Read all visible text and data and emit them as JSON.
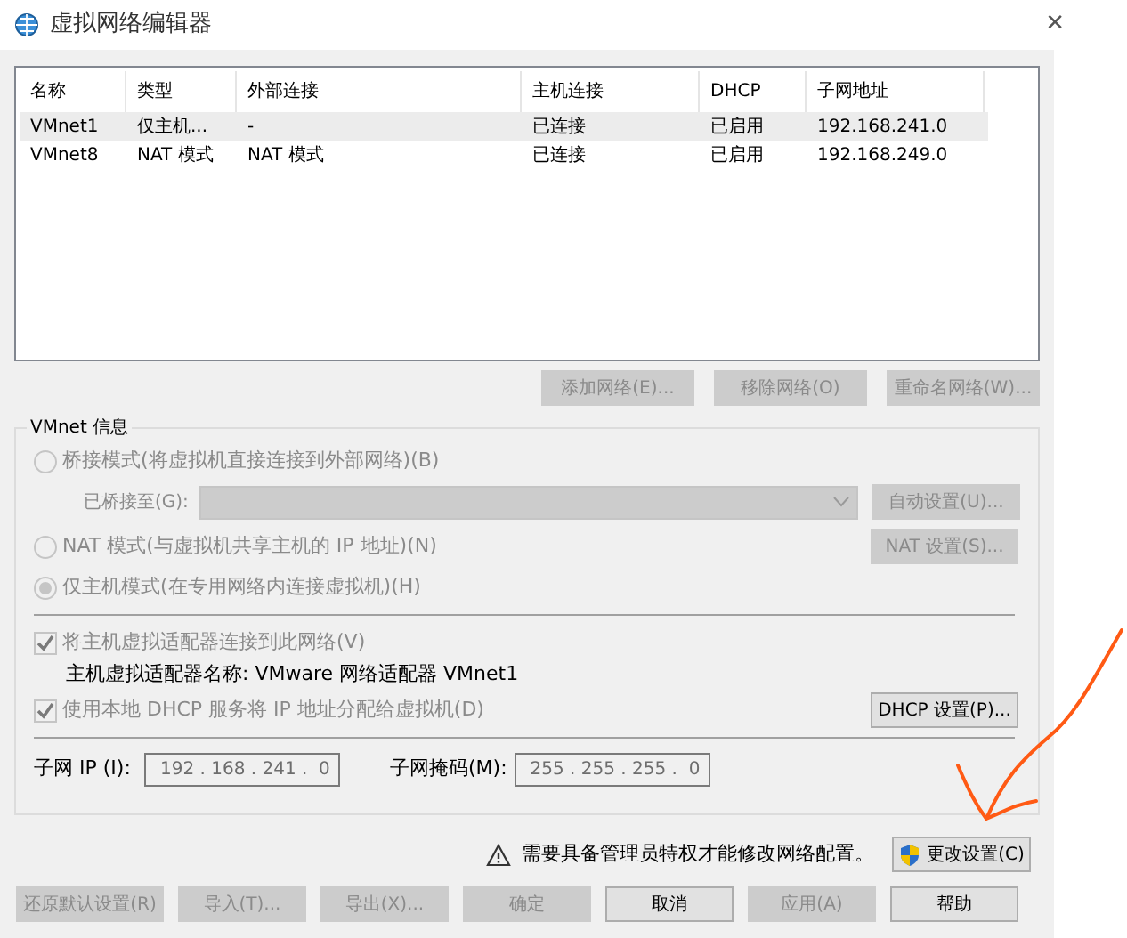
{
  "window": {
    "title": "虚拟网络编辑器",
    "close": "✕"
  },
  "table": {
    "columns": [
      "名称",
      "类型",
      "外部连接",
      "主机连接",
      "DHCP",
      "子网地址"
    ],
    "rows": [
      {
        "cells": [
          "VMnet1",
          "仅主机...",
          "-",
          "已连接",
          "已启用",
          "192.168.241.0"
        ],
        "selected": true
      },
      {
        "cells": [
          "VMnet8",
          "NAT 模式",
          "NAT 模式",
          "已连接",
          "已启用",
          "192.168.249.0"
        ],
        "selected": false
      }
    ]
  },
  "network_buttons": [
    {
      "label": "添加网络(E)...",
      "disabled": true
    },
    {
      "label": "移除网络(O)",
      "disabled": true
    },
    {
      "label": "重命名网络(W)...",
      "disabled": true
    }
  ],
  "vmnet_info": {
    "legend": "VMnet 信息",
    "bridged": {
      "label": "桥接模式(将虚拟机直接连接到外部网络)(B)",
      "selected": false,
      "disabled": true
    },
    "bridged_to": {
      "label": "已桥接至(G):",
      "disabled": true
    },
    "auto_button": {
      "label": "自动设置(U)...",
      "disabled": true
    },
    "nat": {
      "label": "NAT 模式(与虚拟机共享主机的 IP 地址)(N)",
      "selected": false,
      "disabled": true
    },
    "nat_button": {
      "label": "NAT 设置(S)...",
      "disabled": true
    },
    "host_only": {
      "label": "仅主机模式(在专用网络内连接虚拟机)(H)",
      "selected": true,
      "disabled": true
    },
    "connect_adapter": {
      "label": "将主机虚拟适配器连接到此网络(V)",
      "checked": true,
      "disabled": true
    },
    "adapter_name": "主机虚拟适配器名称: VMware 网络适配器 VMnet1",
    "use_dhcp": {
      "label": "使用本地 DHCP 服务将 IP 地址分配给虚拟机(D)",
      "checked": true,
      "disabled": true
    },
    "dhcp_button": {
      "label": "DHCP 设置(P)...",
      "disabled": false
    },
    "subnet_ip": {
      "label": "子网 IP (I):",
      "value": "192 . 168 . 241 .  0"
    },
    "subnet_mask": {
      "label": "子网掩码(M):",
      "value": "255 . 255 . 255 .  0"
    }
  },
  "warning": "需要具备管理员特权才能修改网络配置。",
  "change_settings": {
    "label": "更改设置(C)",
    "disabled": false
  },
  "bottom_buttons": [
    {
      "label": "还原默认设置(R)",
      "disabled": true
    },
    {
      "label": "导入(T)...",
      "disabled": true
    },
    {
      "label": "导出(X)...",
      "disabled": true
    },
    {
      "label": "确定",
      "disabled": true
    },
    {
      "label": "取消",
      "disabled": false
    },
    {
      "label": "应用(A)",
      "disabled": true
    },
    {
      "label": "帮助",
      "disabled": false
    }
  ]
}
